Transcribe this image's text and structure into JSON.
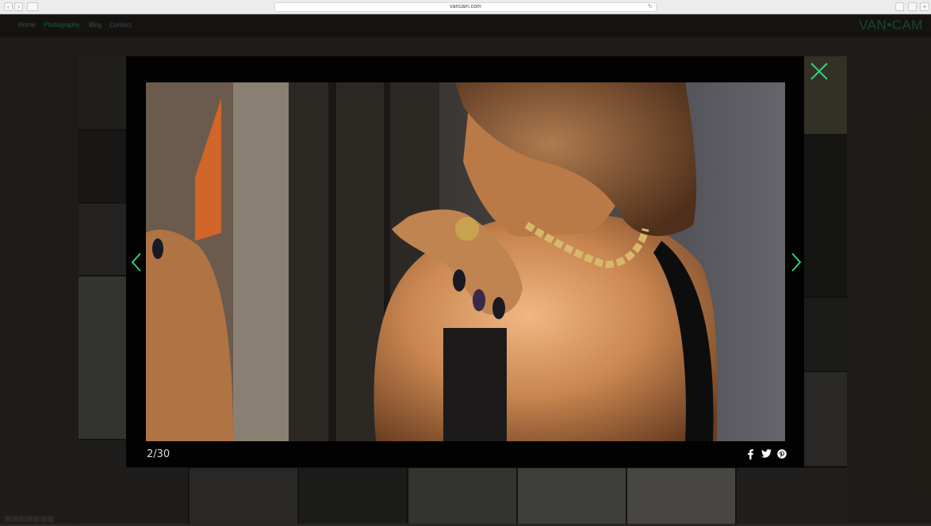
{
  "browser": {
    "url": "vancam.com"
  },
  "site": {
    "logo": "VAN•CAM",
    "nav": [
      "Home",
      "Photography",
      "Blog",
      "Contact"
    ]
  },
  "lightbox": {
    "counter": "2/30",
    "share_icons": [
      "facebook-icon",
      "twitter-icon",
      "pinterest-icon"
    ]
  },
  "colors": {
    "accent": "#2fd07a",
    "nav_active": "#1f5e3b",
    "lightbox_bg": "#020202"
  }
}
